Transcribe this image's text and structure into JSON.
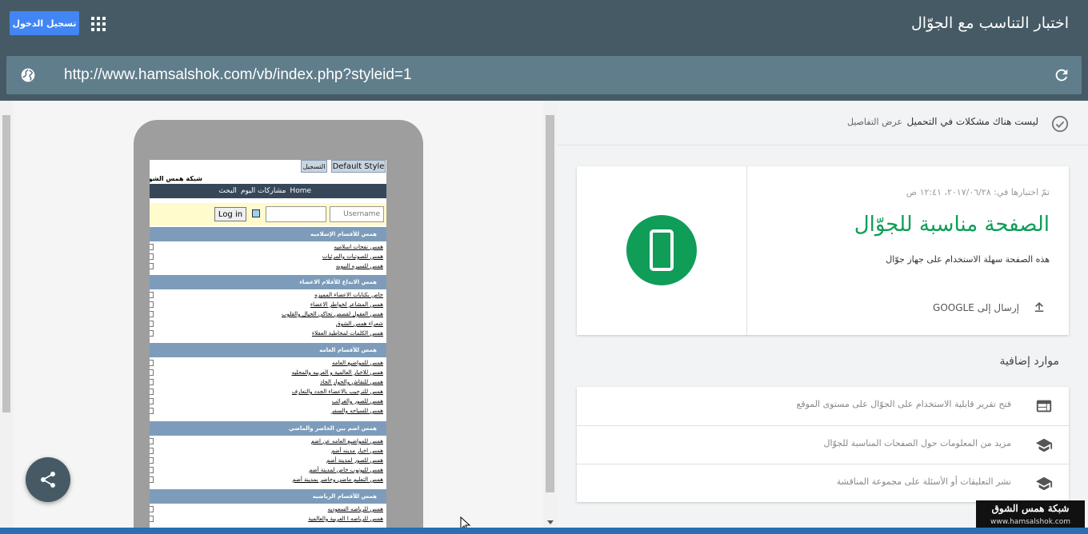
{
  "header": {
    "signin_label": "تسجيل الدخول",
    "title": "اختبار التناسب مع الجوّال"
  },
  "url": {
    "value": "http://www.hamsalshok.com/vb/index.php?styleid=1"
  },
  "preview": {
    "style_button": "Default Style",
    "register_button": "التسجيل",
    "site_name": "شبكة همس الشوق",
    "nav": [
      "Home",
      "مشاركات اليوم",
      "البحث"
    ],
    "username_placeholder": "Username",
    "login_button": "Log in",
    "categories": [
      {
        "title": "همس للأقسام الإسلاميه",
        "forums": [
          "همس نفحات اسلاميه",
          "همس للصوتيات والمرئيات",
          "همس للسيره النبويه"
        ]
      },
      {
        "title": "همس الابداع للأقلام الاعضاء",
        "forums": [
          "خاص بكتابات الاعضاء المميزه",
          "همس المشاعر لخواطر الاعضاء",
          "همس العقول لقصص تحاكي الخيال والقلوب",
          "شعراء همس الشوق",
          "همس الكلمات لمخاطبة العقلاء"
        ]
      },
      {
        "title": "همس للأقسام العامه",
        "forums": [
          "همس للمواضيع العامه",
          "همس للاخبار العالمية و العربيه والمحليه",
          "همس للنقاش والحوار الجاد",
          "همس للترحيب بالاعضاء الجدد والتعارف",
          "همس للصور والغرائب",
          "همس للسياحه والسفر"
        ]
      },
      {
        "title": "همس اضم بين الحاضر والماضي",
        "forums": [
          "همس للمواضيع العامه عن اضم",
          "همس اخبار مدينه أضم",
          "همس للصور لمدينة أضم",
          "همس لليوتوب خاص لمدينة أضم",
          "همس التعليم ماضي وحاضر بمدينة أضم"
        ]
      },
      {
        "title": "همس للأقسام الرياضيه",
        "forums": [
          "همس للرياضه السعوديه",
          "همس للرياضه ا العربية والعالمية"
        ]
      }
    ]
  },
  "status": {
    "issues_text": "ليست هناك مشكلات في التحميل",
    "details_link": "عرض التفاصيل"
  },
  "result": {
    "tested_text": "تمّ اختبارها في: ٢٠١٧/٠٦/٢٨، ١٢:٤١ ص",
    "title": "الصفحة مناسبة للجوّال",
    "description": "هذه الصفحة سهلة الاستخدام على جهاز جوّال",
    "send_label": "إرسال إلى GOOGLE"
  },
  "resources": {
    "title": "موارد إضافية",
    "items": [
      {
        "label": "فتح تقرير قابلية الاستخدام على الجوّال على مستوى الموقع",
        "icon": "web-icon"
      },
      {
        "label": "مزيد من المعلومات حول الصفحات المناسبة للجوّال",
        "icon": "school-icon"
      },
      {
        "label": "نشر التعليقات أو الأسئلة على مجموعة المناقشة",
        "icon": "school-icon"
      }
    ]
  },
  "watermark": {
    "title": "شبكة همس الشوق",
    "url": "www.hamsalshok.com"
  },
  "colors": {
    "header": "#455a64",
    "urlbar": "#607d8b",
    "accent_green": "#0f9d58",
    "primary_blue": "#4285f4"
  }
}
